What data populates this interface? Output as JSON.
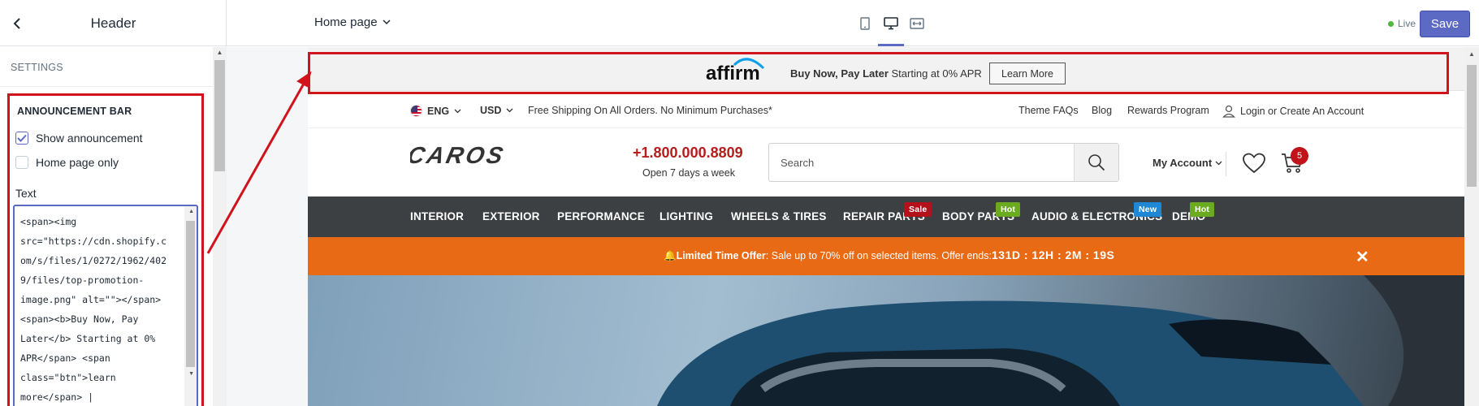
{
  "sidebar": {
    "title": "Header",
    "section_title": "SETTINGS",
    "announcement": {
      "title": "ANNOUNCEMENT BAR",
      "show_label": "Show announcement",
      "show_checked": true,
      "home_only_label": "Home page only",
      "home_only_checked": false,
      "text_label": "Text",
      "text_value": "<span><img\nsrc=\"https://cdn.shopify.c\nom/s/files/1/0272/1962/402\n9/files/top-promotion-\nimage.png\" alt=\"\"></span>\n<span><b>Buy Now, Pay\nLater</b> Starting at 0%\nAPR</span> <span\nclass=\"btn\">learn\nmore</span> |"
    }
  },
  "topbar": {
    "page_select": "Home page",
    "live_label": "Live",
    "save_label": "Save"
  },
  "preview": {
    "announcement": {
      "logo_text": "affirm",
      "bold_text": "Buy Now, Pay Later",
      "text": "Starting at 0% APR",
      "button_label": "Learn More"
    },
    "utility": {
      "language": "ENG",
      "currency": "USD",
      "shipping": "Free Shipping On All Orders. No Minimum Purchases*",
      "links": [
        "Theme FAQs",
        "Blog",
        "Rewards Program"
      ],
      "login": "Login or Create An Account"
    },
    "header": {
      "logo_text": "CAROS",
      "phone": "+1.800.000.8809",
      "phone_sub": "Open 7 days a week",
      "search_placeholder": "Search",
      "my_account": "My Account",
      "cart_count": "5"
    },
    "nav": [
      {
        "label": "INTERIOR"
      },
      {
        "label": "EXTERIOR"
      },
      {
        "label": "PERFORMANCE"
      },
      {
        "label": "LIGHTING"
      },
      {
        "label": "WHEELS & TIRES"
      },
      {
        "label": "REPAIR PARTS",
        "tag": "Sale",
        "tag_color": "#b3121a"
      },
      {
        "label": "BODY PARTS",
        "tag": "Hot",
        "tag_color": "#6aab1f"
      },
      {
        "label": "AUDIO & ELECTRONICS",
        "tag": "New",
        "tag_color": "#1e88d6"
      },
      {
        "label": "DEMO",
        "tag": "Hot",
        "tag_color": "#6aab1f"
      }
    ],
    "promo": {
      "bold": "Limited Time Offer",
      "text": ": Sale up to 70% off on selected items. Offer ends:",
      "countdown": "131D : 12H : 2M : 19S"
    }
  },
  "colors": {
    "accent": "#5c6ac4",
    "highlight": "#d0131c",
    "promo": "#e86a15",
    "nav_bg": "#3d4043"
  }
}
